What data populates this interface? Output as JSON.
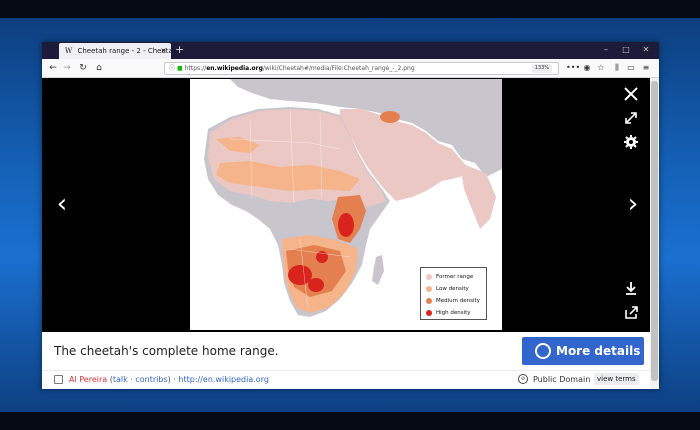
{
  "browser": {
    "tab_title": "Cheetah range - 2 - Cheetah -",
    "tab_favicon": "W",
    "url_host": "en.wikipedia.org",
    "url_prefix": "https://",
    "url_suffix": "/wiki/Cheetah#/media/File:Cheetah_range_-_2.png",
    "zoom": "133%"
  },
  "map": {
    "legend": [
      {
        "label": "Former range",
        "color": "#ecc8c4"
      },
      {
        "label": "Low density",
        "color": "#f5b48a"
      },
      {
        "label": "Medium density",
        "color": "#e48050"
      },
      {
        "label": "High density",
        "color": "#d8241c"
      }
    ],
    "colors": {
      "ocean": "#ffffff",
      "land": "#c9c5cc",
      "former": "#ecc8c4",
      "low": "#f5b48a",
      "medium": "#e48050",
      "high": "#d8241c"
    }
  },
  "caption": {
    "text": "The cheetah's complete home range."
  },
  "more_details": {
    "label": "More details"
  },
  "footer": {
    "author": "Al Pereira",
    "talk_label": "talk",
    "contribs_label": "contribs",
    "source": "http://en.wikipedia.org",
    "license": "Public Domain",
    "view_terms": "view terms"
  },
  "theme": {
    "accent": "#3366cc",
    "tabbar": "#1c1b3a"
  }
}
